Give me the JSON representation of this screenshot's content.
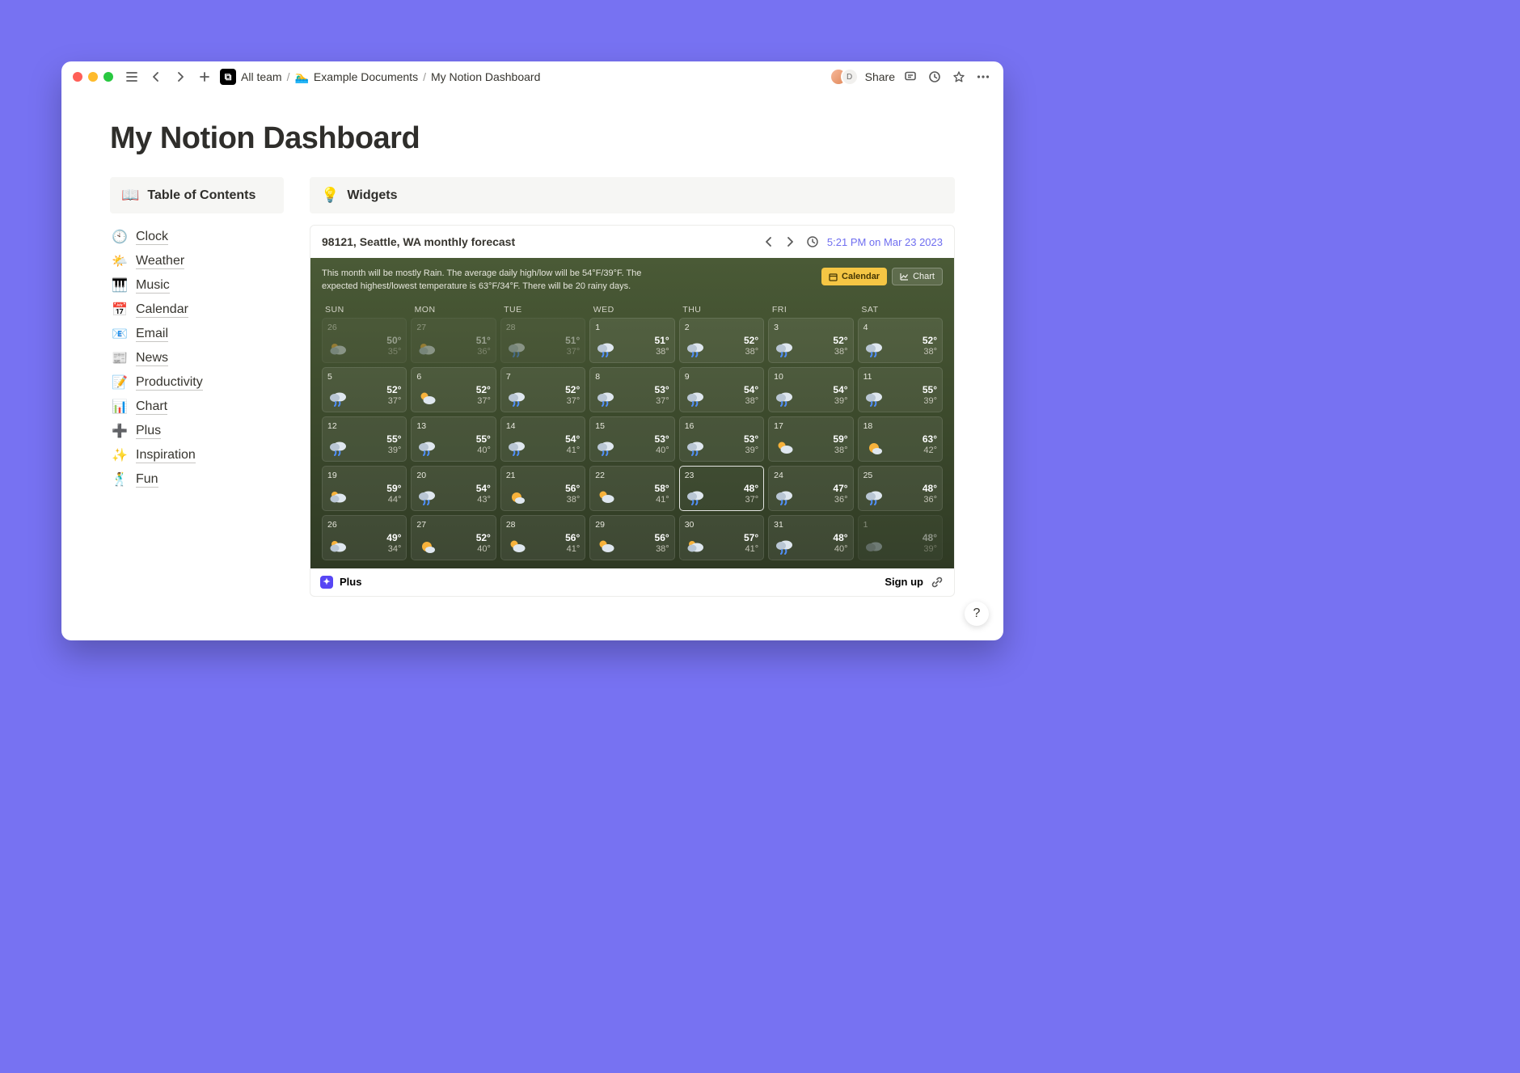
{
  "topbar": {
    "breadcrumb": {
      "workspace": "All team",
      "folder_emoji": "🏊‍♂️",
      "folder": "Example Documents",
      "page": "My Notion Dashboard"
    },
    "share": "Share",
    "avatar_initial": "D"
  },
  "page": {
    "title": "My Notion Dashboard"
  },
  "toc": {
    "header_emoji": "📖",
    "header": "Table of Contents",
    "items": [
      {
        "emoji": "🕙",
        "label": "Clock"
      },
      {
        "emoji": "🌤️",
        "label": "Weather"
      },
      {
        "emoji": "🎹",
        "label": "Music"
      },
      {
        "emoji": "📅",
        "label": "Calendar"
      },
      {
        "emoji": "📧",
        "label": "Email"
      },
      {
        "emoji": "📰",
        "label": "News"
      },
      {
        "emoji": "📝",
        "label": "Productivity"
      },
      {
        "emoji": "📊",
        "label": "Chart"
      },
      {
        "emoji": "➕",
        "label": "Plus"
      },
      {
        "emoji": "✨",
        "label": "Inspiration"
      },
      {
        "emoji": "🕺",
        "label": "Fun"
      }
    ]
  },
  "widgets": {
    "header_emoji": "💡",
    "header": "Widgets",
    "weather": {
      "location": "98121, Seattle, WA monthly forecast",
      "timestamp": "5:21 PM on Mar 23 2023",
      "summary": "This month will be mostly Rain. The average daily high/low will be 54°F/39°F. The expected highest/lowest temperature is 63°F/34°F. There will be 20 rainy days.",
      "btn_calendar": "Calendar",
      "btn_chart": "Chart",
      "dow": [
        "SUN",
        "MON",
        "TUE",
        "WED",
        "THU",
        "FRI",
        "SAT"
      ],
      "days": [
        {
          "n": "26",
          "hi": "50°",
          "lo": "35°",
          "icon": "pcloud",
          "cls": "prev"
        },
        {
          "n": "27",
          "hi": "51°",
          "lo": "36°",
          "icon": "pcloud",
          "cls": "prev"
        },
        {
          "n": "28",
          "hi": "51°",
          "lo": "37°",
          "icon": "rain",
          "cls": "prev"
        },
        {
          "n": "1",
          "hi": "51°",
          "lo": "38°",
          "icon": "rain",
          "cls": ""
        },
        {
          "n": "2",
          "hi": "52°",
          "lo": "38°",
          "icon": "rain",
          "cls": ""
        },
        {
          "n": "3",
          "hi": "52°",
          "lo": "38°",
          "icon": "rain",
          "cls": ""
        },
        {
          "n": "4",
          "hi": "52°",
          "lo": "38°",
          "icon": "rain",
          "cls": ""
        },
        {
          "n": "5",
          "hi": "52°",
          "lo": "37°",
          "icon": "rain",
          "cls": ""
        },
        {
          "n": "6",
          "hi": "52°",
          "lo": "37°",
          "icon": "sun",
          "cls": ""
        },
        {
          "n": "7",
          "hi": "52°",
          "lo": "37°",
          "icon": "rain",
          "cls": ""
        },
        {
          "n": "8",
          "hi": "53°",
          "lo": "37°",
          "icon": "rain",
          "cls": ""
        },
        {
          "n": "9",
          "hi": "54°",
          "lo": "38°",
          "icon": "rain",
          "cls": ""
        },
        {
          "n": "10",
          "hi": "54°",
          "lo": "39°",
          "icon": "rain",
          "cls": ""
        },
        {
          "n": "11",
          "hi": "55°",
          "lo": "39°",
          "icon": "rain",
          "cls": ""
        },
        {
          "n": "12",
          "hi": "55°",
          "lo": "39°",
          "icon": "rain",
          "cls": ""
        },
        {
          "n": "13",
          "hi": "55°",
          "lo": "40°",
          "icon": "rain",
          "cls": ""
        },
        {
          "n": "14",
          "hi": "54°",
          "lo": "41°",
          "icon": "rain",
          "cls": ""
        },
        {
          "n": "15",
          "hi": "53°",
          "lo": "40°",
          "icon": "rain",
          "cls": ""
        },
        {
          "n": "16",
          "hi": "53°",
          "lo": "39°",
          "icon": "rain",
          "cls": ""
        },
        {
          "n": "17",
          "hi": "59°",
          "lo": "38°",
          "icon": "sun",
          "cls": ""
        },
        {
          "n": "18",
          "hi": "63°",
          "lo": "42°",
          "icon": "sunny",
          "cls": ""
        },
        {
          "n": "19",
          "hi": "59°",
          "lo": "44°",
          "icon": "pcloud",
          "cls": ""
        },
        {
          "n": "20",
          "hi": "54°",
          "lo": "43°",
          "icon": "rain",
          "cls": ""
        },
        {
          "n": "21",
          "hi": "56°",
          "lo": "38°",
          "icon": "sunny",
          "cls": ""
        },
        {
          "n": "22",
          "hi": "58°",
          "lo": "41°",
          "icon": "sun",
          "cls": ""
        },
        {
          "n": "23",
          "hi": "48°",
          "lo": "37°",
          "icon": "rain",
          "cls": "today"
        },
        {
          "n": "24",
          "hi": "47°",
          "lo": "36°",
          "icon": "rain",
          "cls": ""
        },
        {
          "n": "25",
          "hi": "48°",
          "lo": "36°",
          "icon": "rain",
          "cls": ""
        },
        {
          "n": "26",
          "hi": "49°",
          "lo": "34°",
          "icon": "pcloud",
          "cls": ""
        },
        {
          "n": "27",
          "hi": "52°",
          "lo": "40°",
          "icon": "sunny",
          "cls": ""
        },
        {
          "n": "28",
          "hi": "56°",
          "lo": "41°",
          "icon": "sun",
          "cls": ""
        },
        {
          "n": "29",
          "hi": "56°",
          "lo": "38°",
          "icon": "sun",
          "cls": ""
        },
        {
          "n": "30",
          "hi": "57°",
          "lo": "41°",
          "icon": "pcloud",
          "cls": ""
        },
        {
          "n": "31",
          "hi": "48°",
          "lo": "40°",
          "icon": "rain",
          "cls": ""
        },
        {
          "n": "1",
          "hi": "48°",
          "lo": "39°",
          "icon": "cloud",
          "cls": "next"
        }
      ],
      "footer_brand": "Plus",
      "signup": "Sign up"
    }
  },
  "help": "?"
}
